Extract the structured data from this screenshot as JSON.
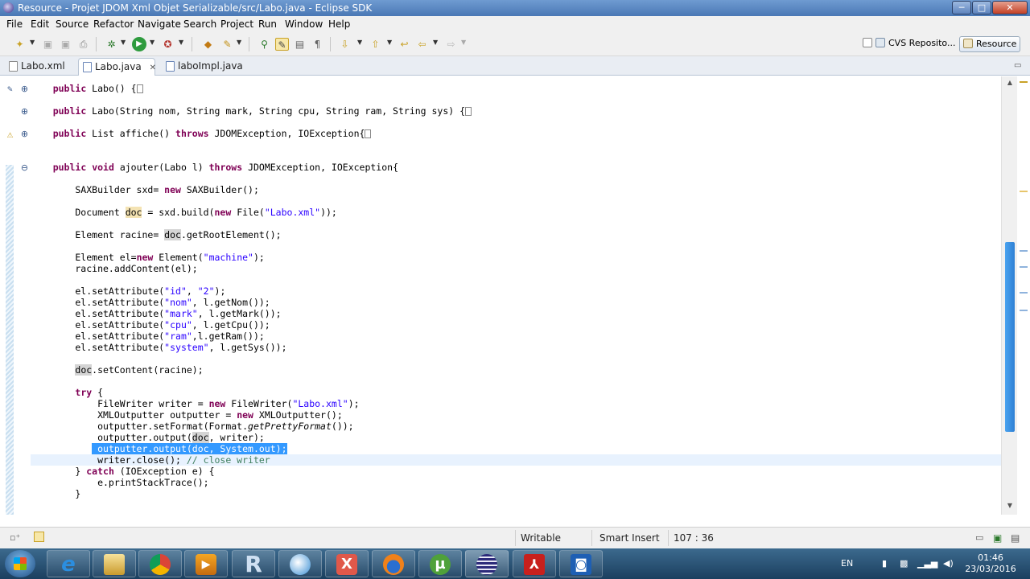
{
  "window": {
    "title": "Resource - Projet JDOM Xml Objet Serializable/src/Labo.java - Eclipse SDK",
    "min_label": "─",
    "max_label": "□",
    "close_label": "✕"
  },
  "menu": [
    "File",
    "Edit",
    "Source",
    "Refactor",
    "Navigate",
    "Search",
    "Project",
    "Run",
    "Window",
    "Help"
  ],
  "perspectives": {
    "cvs": "CVS Reposito...",
    "resource": "Resource"
  },
  "tabs": [
    {
      "label": "Labo.xml",
      "active": false
    },
    {
      "label": "Labo.java",
      "active": true
    },
    {
      "label": "laboImpl.java",
      "active": false
    }
  ],
  "tab_close": "✕",
  "code_lines": [
    "    public Labo() {",
    "    public Labo(String nom, String mark, String cpu, String ram, String sys) {",
    "    public List affiche() throws JDOMException, IOException{",
    "    public void ajouter(Labo l) throws JDOMException, IOException{",
    "        SAXBuilder sxd= new SAXBuilder();",
    "        Document doc = sxd.build(new File(\"Labo.xml\"));",
    "        Element racine= doc.getRootElement();",
    "        Element el=new Element(\"machine\");",
    "        racine.addContent(el);",
    "        el.setAttribute(\"id\", \"2\");",
    "        el.setAttribute(\"nom\", l.getNom());",
    "        el.setAttribute(\"mark\", l.getMark());",
    "        el.setAttribute(\"cpu\", l.getCpu());",
    "        el.setAttribute(\"ram\",l.getRam());",
    "        el.setAttribute(\"system\", l.getSys());",
    "        doc.setContent(racine);",
    "        try {",
    "            FileWriter writer = new FileWriter(\"Labo.xml\");",
    "            XMLOutputter outputter = new XMLOutputter();",
    "            outputter.setFormat(Format.getPrettyFormat());",
    "            outputter.output(doc, writer);",
    "            outputter.output(doc, System.out);",
    "            writer.close(); // close writer",
    "        } catch (IOException e) {",
    "            e.printStackTrace();",
    "        }"
  ],
  "status": {
    "mode": "Writable",
    "insert": "Smart Insert",
    "position": "107 : 36"
  },
  "tray": {
    "language": "EN",
    "time": "01:46",
    "date": "23/03/2016"
  },
  "taskbar_apps": [
    "ie-icon",
    "explorer-icon",
    "chrome-icon",
    "media-player-icon",
    "r-icon",
    "app-icon",
    "xampp-icon",
    "firefox-icon",
    "utorrent-icon",
    "eclipse-icon",
    "acrobat-icon",
    "teamviewer-icon"
  ],
  "colors": {
    "keyword": "#7f0055",
    "string": "#2a00ff",
    "comment": "#3f7f5f",
    "selection": "#3399ff",
    "current_line": "#e8f2fe"
  }
}
